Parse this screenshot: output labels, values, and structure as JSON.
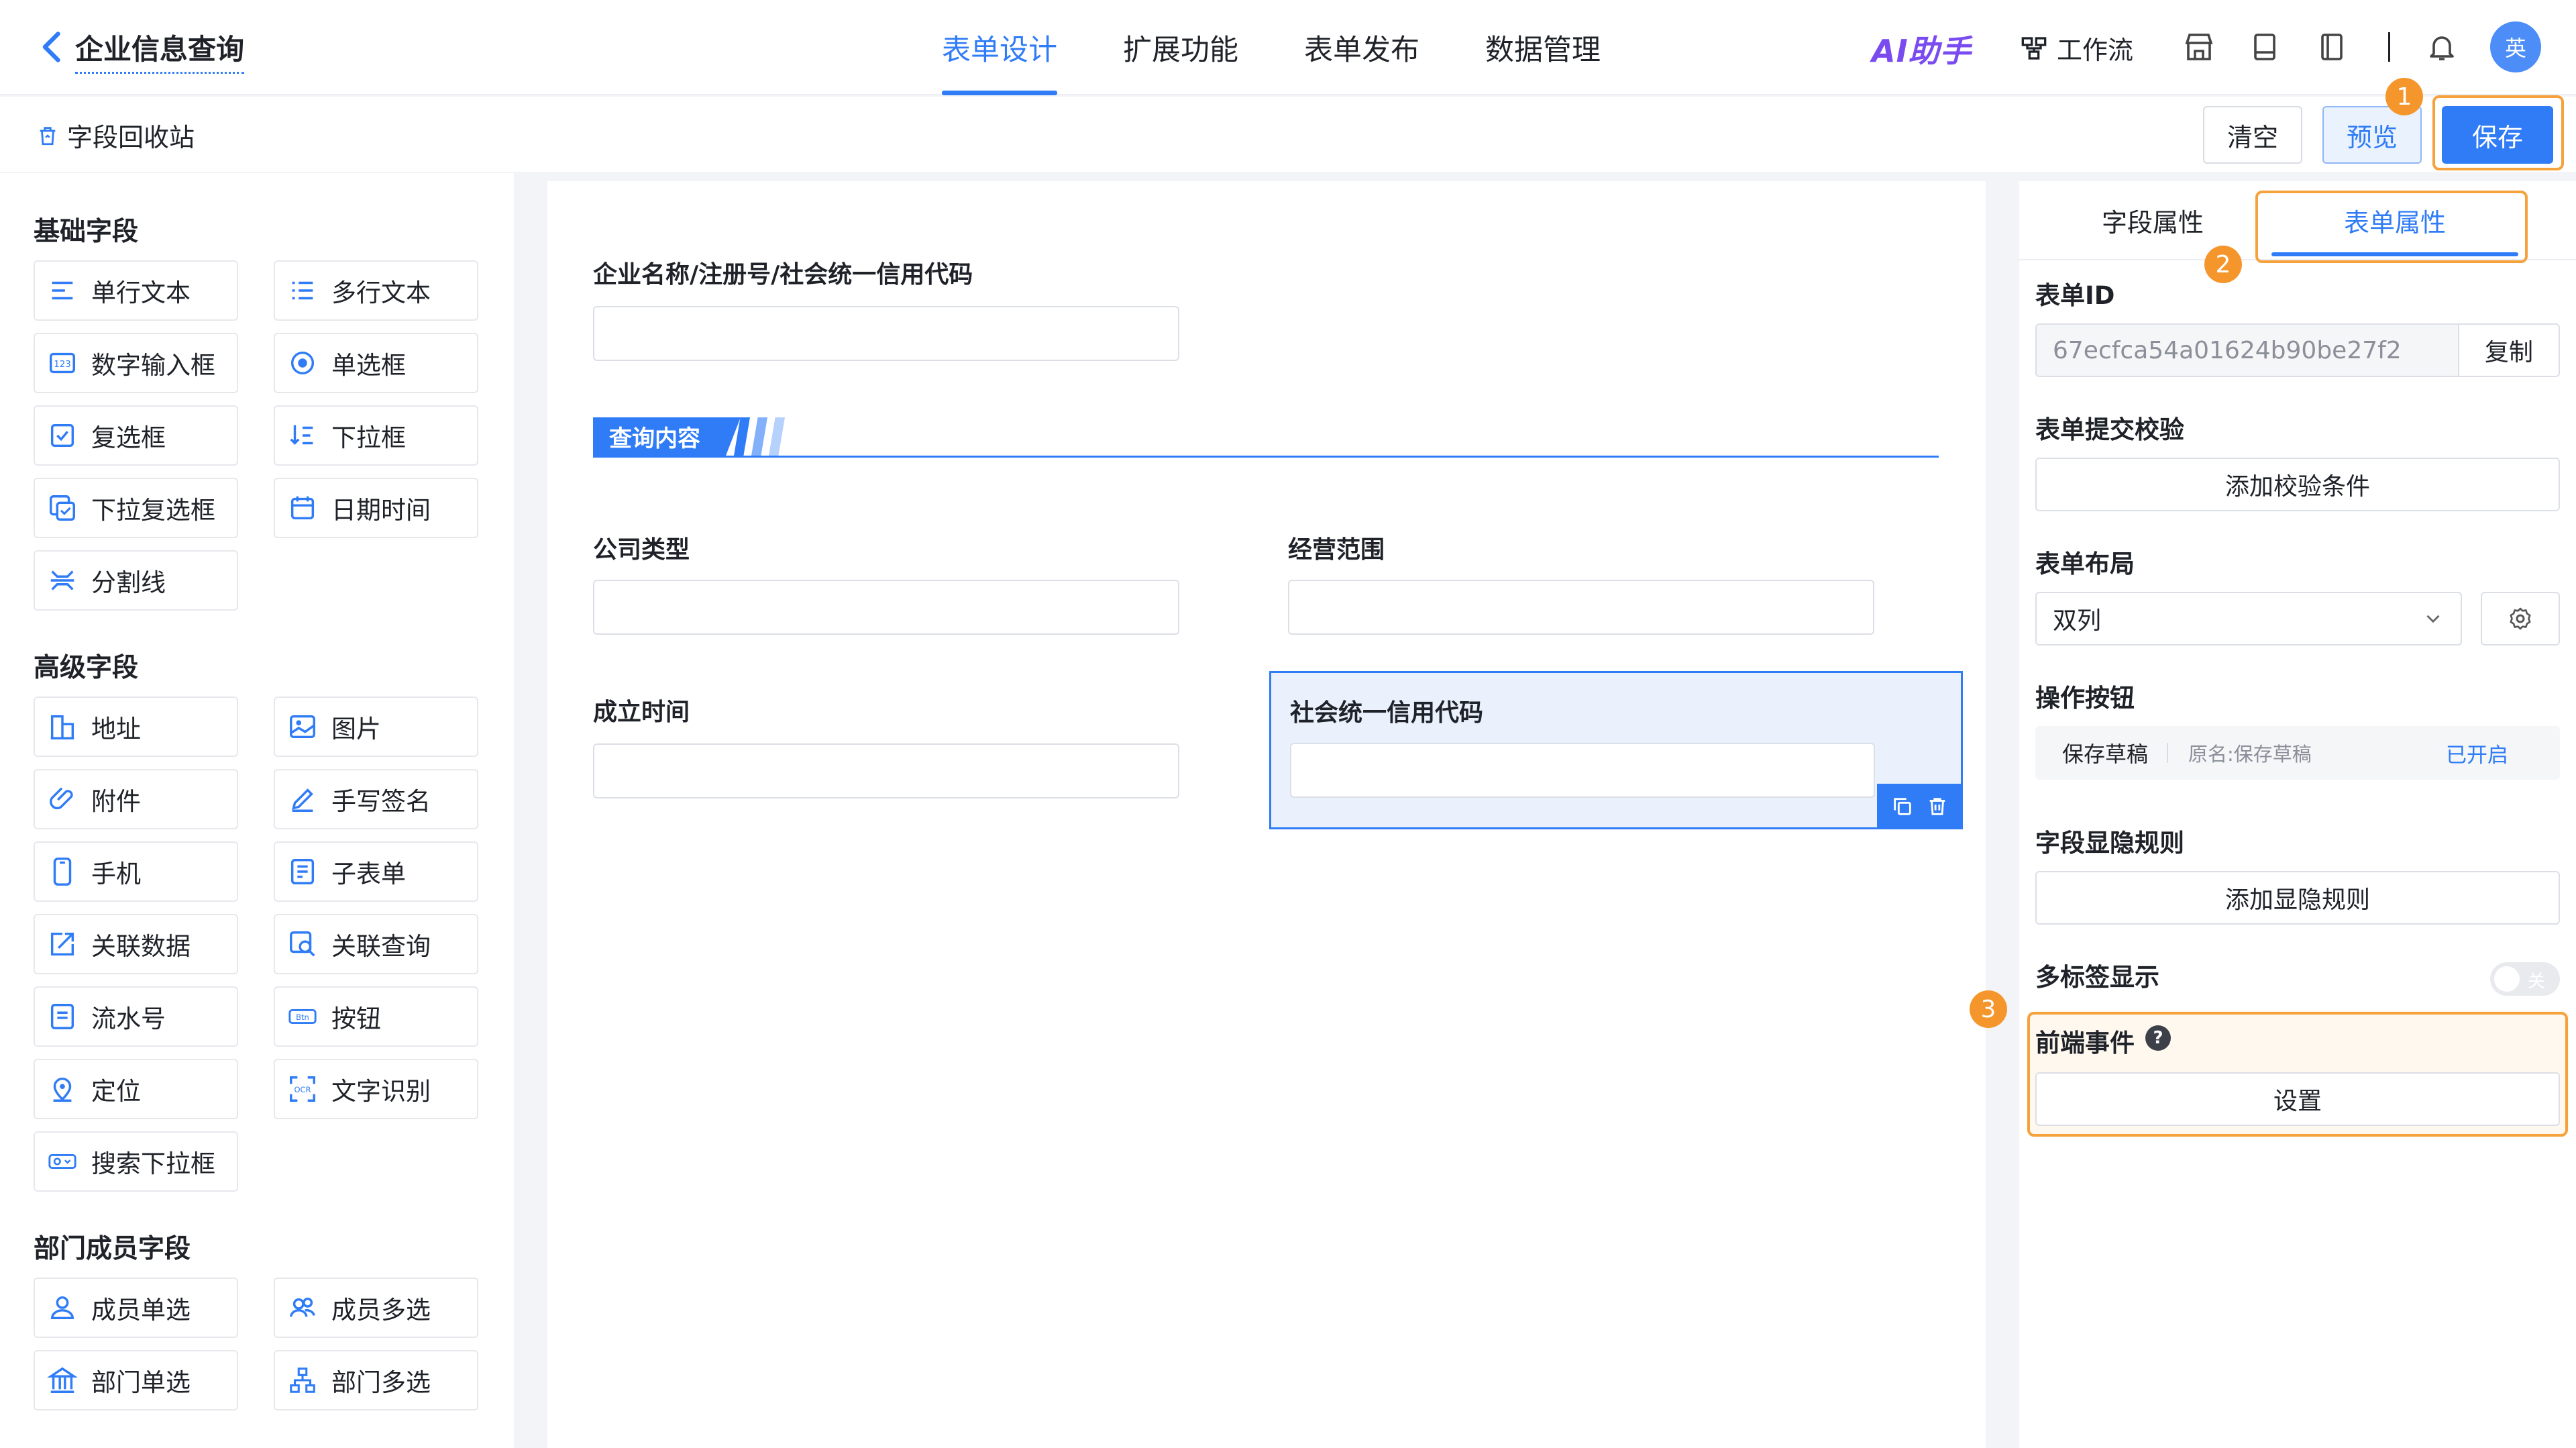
{
  "app": {
    "title": "企业信息查询"
  },
  "nav": {
    "tabs": [
      "表单设计",
      "扩展功能",
      "表单发布",
      "数据管理"
    ],
    "active_index": 0
  },
  "header": {
    "ai_label": "AI助手",
    "workflow_label": "工作流",
    "avatar_text": "英"
  },
  "toolbar": {
    "recycle_label": "字段回收站",
    "clear_label": "清空",
    "preview_label": "预览",
    "save_label": "保存"
  },
  "annotations": {
    "step1": "1",
    "step2": "2",
    "step3": "3",
    "highlight_color": "#f6a23c"
  },
  "palette": {
    "basic_title": "基础字段",
    "basic": [
      {
        "label": "单行文本",
        "icon": "single-line-icon"
      },
      {
        "label": "多行文本",
        "icon": "multi-line-icon"
      },
      {
        "label": "数字输入框",
        "icon": "number-icon"
      },
      {
        "label": "单选框",
        "icon": "radio-icon"
      },
      {
        "label": "复选框",
        "icon": "checkbox-icon"
      },
      {
        "label": "下拉框",
        "icon": "dropdown-icon"
      },
      {
        "label": "下拉复选框",
        "icon": "dropdown-checkbox-icon"
      },
      {
        "label": "日期时间",
        "icon": "calendar-icon"
      },
      {
        "label": "分割线",
        "icon": "divider-icon"
      }
    ],
    "advanced_title": "高级字段",
    "advanced": [
      {
        "label": "地址",
        "icon": "address-icon"
      },
      {
        "label": "图片",
        "icon": "image-icon"
      },
      {
        "label": "附件",
        "icon": "attachment-icon"
      },
      {
        "label": "手写签名",
        "icon": "signature-icon"
      },
      {
        "label": "手机",
        "icon": "phone-icon"
      },
      {
        "label": "子表单",
        "icon": "subform-icon"
      },
      {
        "label": "关联数据",
        "icon": "link-data-icon"
      },
      {
        "label": "关联查询",
        "icon": "link-query-icon"
      },
      {
        "label": "流水号",
        "icon": "serial-icon"
      },
      {
        "label": "按钮",
        "icon": "button-icon"
      },
      {
        "label": "定位",
        "icon": "location-icon"
      },
      {
        "label": "文字识别",
        "icon": "ocr-icon"
      },
      {
        "label": "搜索下拉框",
        "icon": "search-dropdown-icon"
      }
    ],
    "member_title": "部门成员字段",
    "member": [
      {
        "label": "成员单选",
        "icon": "member-single-icon"
      },
      {
        "label": "成员多选",
        "icon": "member-multi-icon"
      },
      {
        "label": "部门单选",
        "icon": "dept-single-icon"
      },
      {
        "label": "部门多选",
        "icon": "dept-multi-icon"
      }
    ]
  },
  "canvas": {
    "search_label": "企业名称/注册号/社会统一信用代码",
    "section_title": "查询内容",
    "fields": [
      "公司类型",
      "经营范围",
      "成立时间",
      "社会统一信用代码"
    ]
  },
  "panel": {
    "tabs": [
      "字段属性",
      "表单属性"
    ],
    "active_tab": 1,
    "form_id_label": "表单ID",
    "form_id_value": "67ecfca54a01624b90be27f2",
    "copy_label": "复制",
    "validation_label": "表单提交校验",
    "validation_button": "添加校验条件",
    "layout_label": "表单布局",
    "layout_value": "双列",
    "actions_label": "操作按钮",
    "action_name": "保存草稿",
    "action_original": "原名:保存草稿",
    "action_status": "已开启",
    "visibility_label": "字段显隐规则",
    "visibility_button": "添加显隐规则",
    "multitab_label": "多标签显示",
    "multitab_toggle": "关",
    "events_label": "前端事件",
    "events_button": "设置"
  }
}
